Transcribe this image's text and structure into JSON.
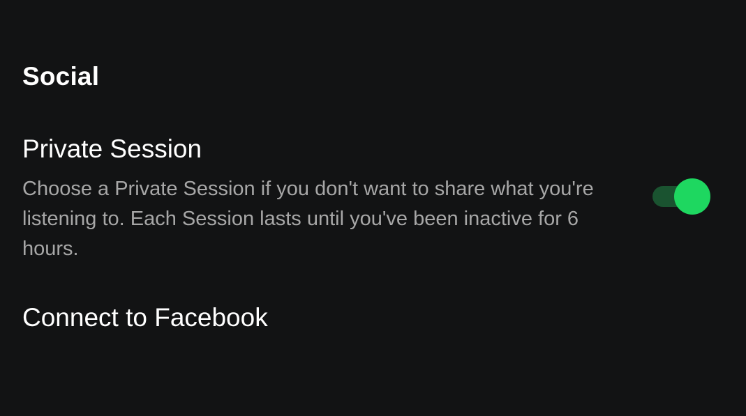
{
  "section": {
    "title": "Social"
  },
  "private_session": {
    "title": "Private Session",
    "description": "Choose a Private Session if you don't want to share what you're listening to. Each Session lasts until you've been inactive for 6 hours.",
    "enabled": true,
    "toggle_on_color": "#1ed760",
    "toggle_track_color": "#1a5330"
  },
  "facebook": {
    "label": "Connect to Facebook"
  },
  "theme": {
    "background": "#121314",
    "text_primary": "#ffffff",
    "text_secondary": "#a7a7a7"
  }
}
